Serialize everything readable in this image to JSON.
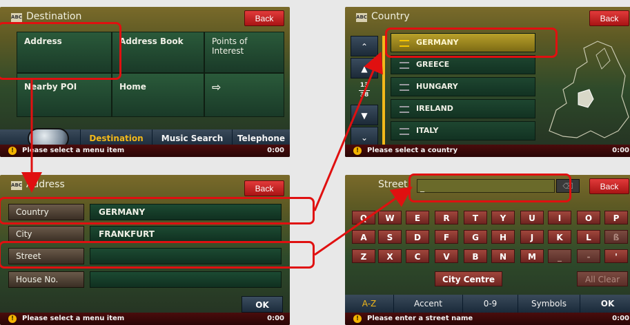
{
  "destination_panel": {
    "title": "Destination",
    "title_icon": "abc-icon",
    "back_label": "Back",
    "tiles": [
      {
        "label": "Address"
      },
      {
        "label": "Address Book"
      },
      {
        "label": "Points of\nInterest"
      },
      {
        "label": "Nearby POI"
      },
      {
        "label": "Home"
      },
      {
        "label": "⇨"
      }
    ],
    "tabs": [
      {
        "label": "Destination",
        "active": true
      },
      {
        "label": "Music Search",
        "active": false
      },
      {
        "label": "Telephone",
        "active": false
      }
    ],
    "status": {
      "text": "Please select a menu item",
      "time": "0:00"
    }
  },
  "country_panel": {
    "title": "Country",
    "back_label": "Back",
    "counter_top": "13",
    "counter_bottom": "38",
    "countries": [
      {
        "name": "GERMANY",
        "selected": true
      },
      {
        "name": "GREECE",
        "selected": false
      },
      {
        "name": "HUNGARY",
        "selected": false
      },
      {
        "name": "IRELAND",
        "selected": false
      },
      {
        "name": "ITALY",
        "selected": false
      }
    ],
    "status": {
      "text": "Please select a country",
      "time": "0:00"
    }
  },
  "address_panel": {
    "title": "Address",
    "back_label": "Back",
    "fields": [
      {
        "label": "Country",
        "value": "GERMANY"
      },
      {
        "label": "City",
        "value": "FRANKFURT"
      },
      {
        "label": "Street",
        "value": ""
      },
      {
        "label": "House No.",
        "value": ""
      }
    ],
    "ok_label": "OK",
    "status": {
      "text": "Please select a menu item",
      "time": "0:00"
    }
  },
  "street_panel": {
    "input_label": "Street:",
    "input_value": "_",
    "back_label": "Back",
    "rows": [
      [
        "Q",
        "W",
        "E",
        "R",
        "T",
        "Y",
        "U",
        "I",
        "O",
        "P"
      ],
      [
        "A",
        "S",
        "D",
        "F",
        "G",
        "H",
        "J",
        "K",
        "L",
        "ß"
      ],
      [
        "Z",
        "X",
        "C",
        "V",
        "B",
        "N",
        "M",
        "_",
        "-",
        "'"
      ]
    ],
    "city_centre_label": "City Centre",
    "all_clear_label": "All Clear",
    "modes": [
      {
        "label": "A-Z",
        "active": true
      },
      {
        "label": "Accent",
        "active": false
      },
      {
        "label": "0-9",
        "active": false
      },
      {
        "label": "Symbols",
        "active": false
      }
    ],
    "ok_label": "OK",
    "status": {
      "text": "Please enter a street name",
      "time": "0:00"
    }
  },
  "colors": {
    "highlight": "#e01010",
    "accent": "#f2b81a",
    "back_button": "#c62020"
  }
}
